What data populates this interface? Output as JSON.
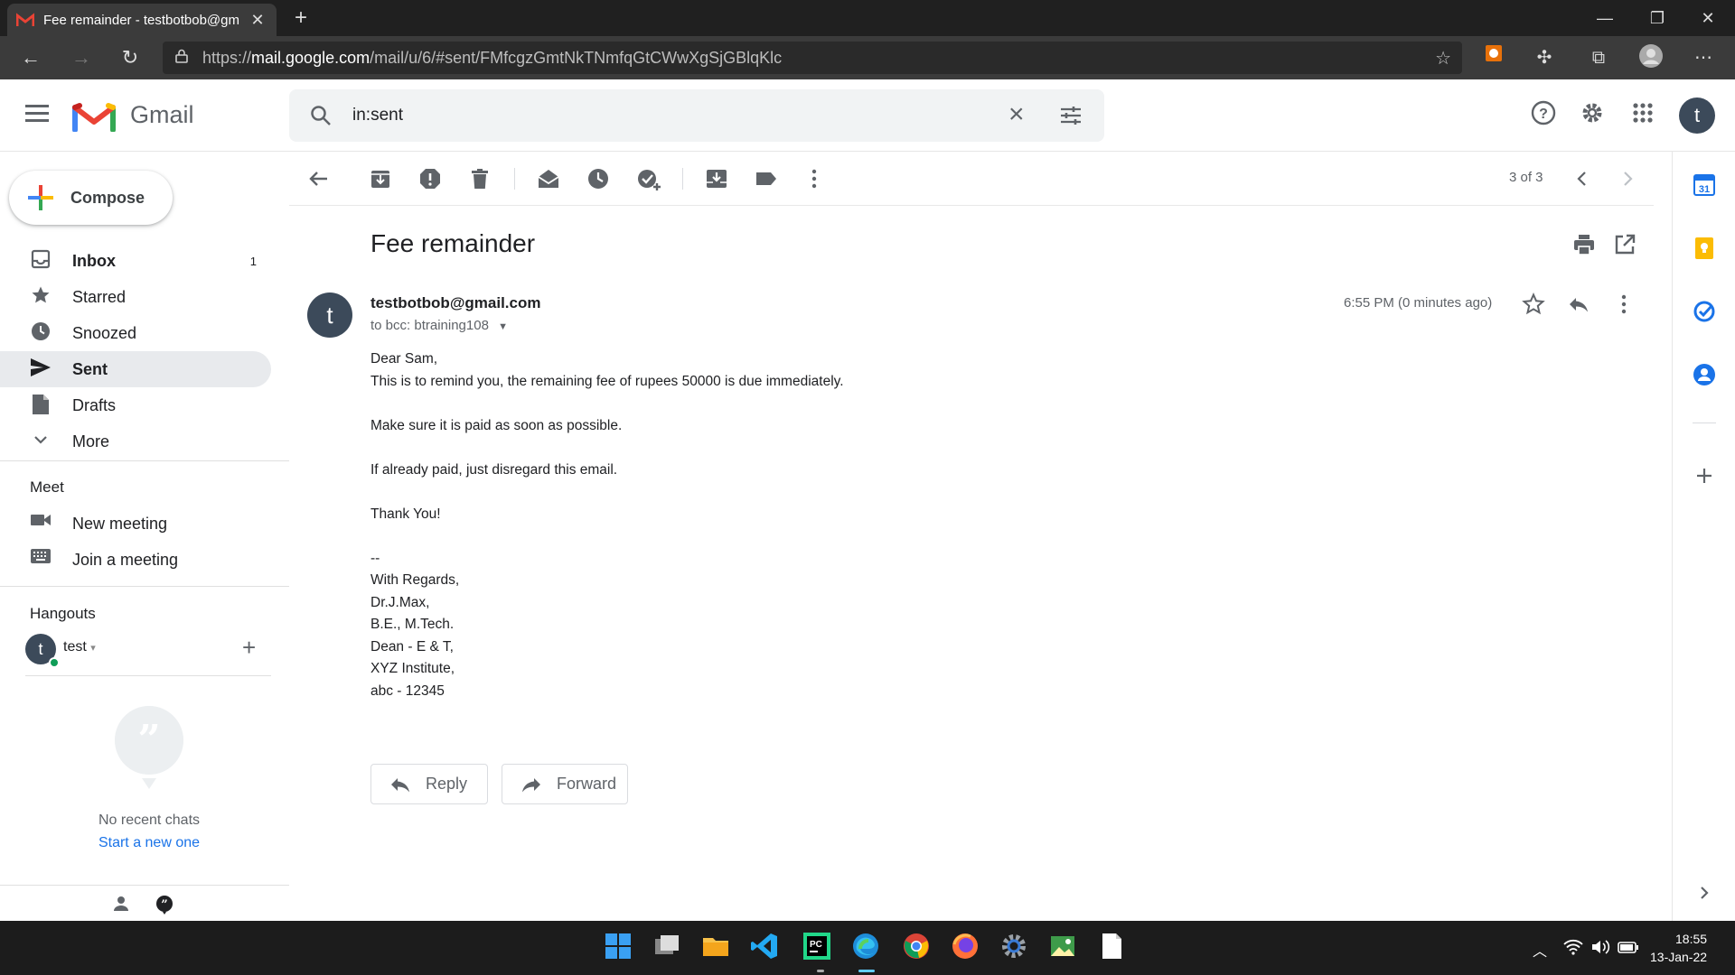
{
  "browser": {
    "tab_title": "Fee remainder - testbotbob@gm",
    "url_prefix": "https://",
    "url_host": "mail.google.com",
    "url_path": "/mail/u/6/#sent/FMfcgzGmtNkTNmfqGtCWwXgSjGBlqKlc"
  },
  "gmail": {
    "brand": "Gmail",
    "search_value": "in:sent",
    "avatar_letter": "t"
  },
  "sidebar": {
    "compose_label": "Compose",
    "items": [
      {
        "label": "Inbox",
        "count": "1",
        "icon": "inbox-icon"
      },
      {
        "label": "Starred",
        "icon": "star-icon"
      },
      {
        "label": "Snoozed",
        "icon": "clock-icon"
      },
      {
        "label": "Sent",
        "icon": "send-icon"
      },
      {
        "label": "Drafts",
        "icon": "draft-icon"
      },
      {
        "label": "More",
        "icon": "chevron-down-icon"
      }
    ],
    "meet_title": "Meet",
    "meet_items": [
      {
        "label": "New meeting",
        "icon": "video-icon"
      },
      {
        "label": "Join a meeting",
        "icon": "keyboard-icon"
      }
    ],
    "hangouts_title": "Hangouts",
    "hangouts_user": "test",
    "no_recent": "No recent chats",
    "start_new": "Start a new one"
  },
  "toolbar": {
    "pager": "3 of 3"
  },
  "message": {
    "subject": "Fee remainder",
    "sender": "testbotbob@gmail.com",
    "sender_initial": "t",
    "recipients": "to bcc: btraining108",
    "time": "6:55 PM (0 minutes ago)",
    "body": "Dear Sam,\nThis is to remind you, the remaining fee of rupees 50000 is due immediately.\n\nMake sure it is paid as soon as possible.\n\nIf already paid, just disregard this email.\n\nThank You!\n\n--\nWith Regards,\nDr.J.Max,\nB.E., M.Tech.\nDean - E & T,\nXYZ Institute,\nabc - 12345",
    "reply_label": "Reply",
    "forward_label": "Forward"
  },
  "taskbar": {
    "time": "18:55",
    "date": "13-Jan-22"
  },
  "colors": {
    "accent_blue": "#1a73e8",
    "active_nav_bg": "#e8eaed",
    "avatar_bg": "#3c4a5a"
  }
}
